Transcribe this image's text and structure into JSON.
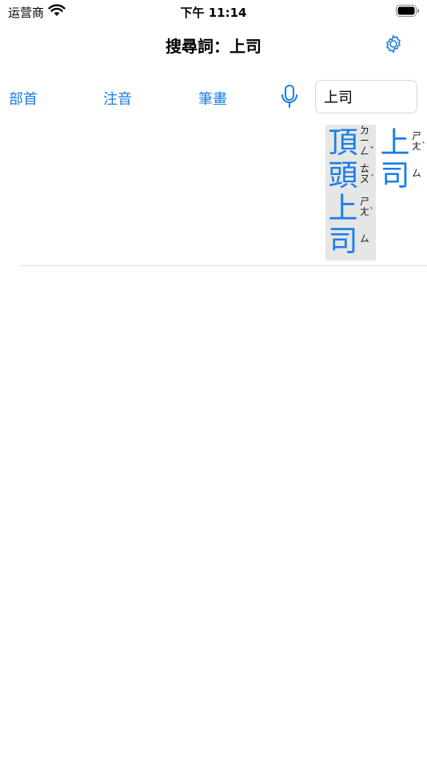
{
  "status_bar": {
    "carrier": "运营商",
    "time": "下午 11:14"
  },
  "nav": {
    "title": "搜尋詞：上司",
    "settings_icon": "gear-icon"
  },
  "toolbar": {
    "radical_label": "部首",
    "zhuyin_label": "注音",
    "stroke_label": "筆畫",
    "mic_icon": "microphone-icon",
    "search_value": "上司"
  },
  "results": [
    {
      "word": "頂頭上司",
      "chars": [
        "頂",
        "頭",
        "上",
        "司"
      ],
      "zhuyin": [
        "ㄉㄧㄥˇ",
        "ㄊㄡˊ",
        "ㄕㄤˋ",
        "ㄙ"
      ],
      "selected": true
    },
    {
      "word": "上司",
      "chars": [
        "上",
        "司"
      ],
      "zhuyin": [
        "ㄕㄤˋ",
        "ㄙ"
      ],
      "selected": false
    }
  ],
  "colors": {
    "accent": "#1a7ee6",
    "selected_bg": "#e6e6e6",
    "divider": "#dcdcdc"
  }
}
